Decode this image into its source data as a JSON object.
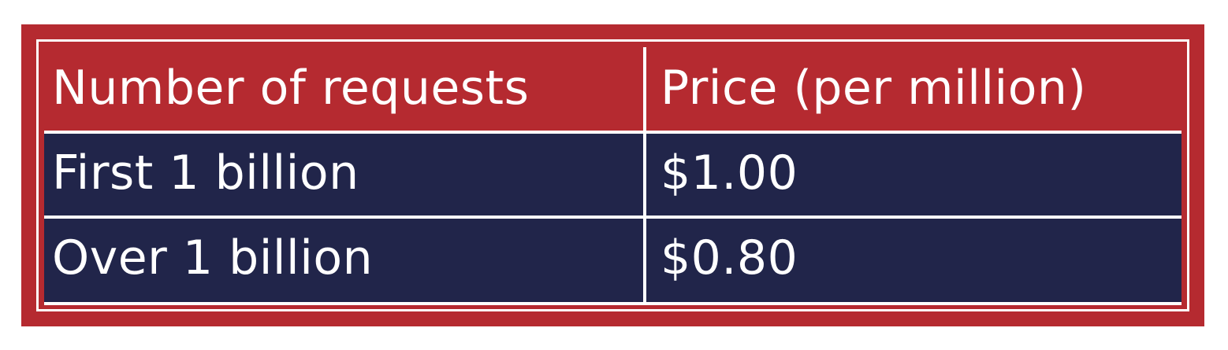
{
  "table": {
    "headers": [
      "Number of requests",
      "Price (per million)"
    ],
    "rows": [
      [
        "First 1 billion",
        "$1.00"
      ],
      [
        "Over 1 billion",
        "$0.80"
      ]
    ]
  },
  "colors": {
    "header_background": "#b52a30",
    "row_background": "#21254a",
    "border": "#ffffff",
    "text": "#ffffff"
  }
}
